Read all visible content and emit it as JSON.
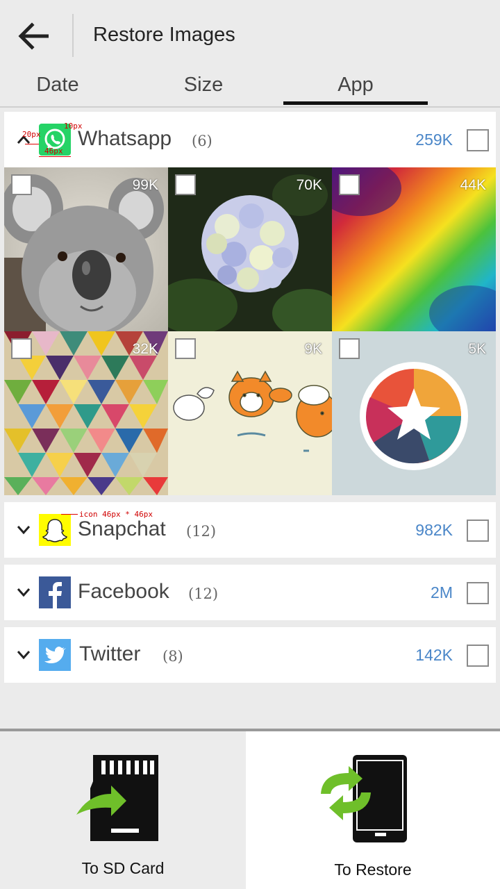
{
  "header": {
    "title": "Restore Images",
    "back_icon": "arrow-left-icon"
  },
  "tabs": [
    {
      "label": "Date",
      "active": false
    },
    {
      "label": "Size",
      "active": false
    },
    {
      "label": "App",
      "active": true
    }
  ],
  "colors": {
    "accent": "#4a86c8",
    "whatsapp": "#25d366",
    "snapchat": "#fffc00",
    "facebook": "#3b5998",
    "twitter": "#55acee",
    "arrow_green": "#6fbf2a"
  },
  "groups": [
    {
      "app": "Whatsapp",
      "count": "(6)",
      "size": "259K",
      "expanded": true,
      "icon": "whatsapp-icon",
      "images": [
        {
          "size": "99K",
          "subject": "koala"
        },
        {
          "size": "70K",
          "subject": "hydrangea"
        },
        {
          "size": "44K",
          "subject": "rainbow-watercolor"
        },
        {
          "size": "32K",
          "subject": "triangle-pattern"
        },
        {
          "size": "9K",
          "subject": "fox-cartoon"
        },
        {
          "size": "5K",
          "subject": "star-logo"
        }
      ]
    },
    {
      "app": "Snapchat",
      "count": "(12)",
      "size": "982K",
      "expanded": false,
      "icon": "snapchat-icon"
    },
    {
      "app": "Facebook",
      "count": "(12)",
      "size": "2M",
      "expanded": false,
      "icon": "facebook-icon"
    },
    {
      "app": "Twitter",
      "count": "(8)",
      "size": "142K",
      "expanded": false,
      "icon": "twitter-icon"
    }
  ],
  "annotations": {
    "a1": "20px",
    "a2": "10px",
    "a3": "46px",
    "a4": "icon 46px * 46px"
  },
  "bottom": {
    "sd_label": "To SD Card",
    "restore_label": "To Restore"
  }
}
